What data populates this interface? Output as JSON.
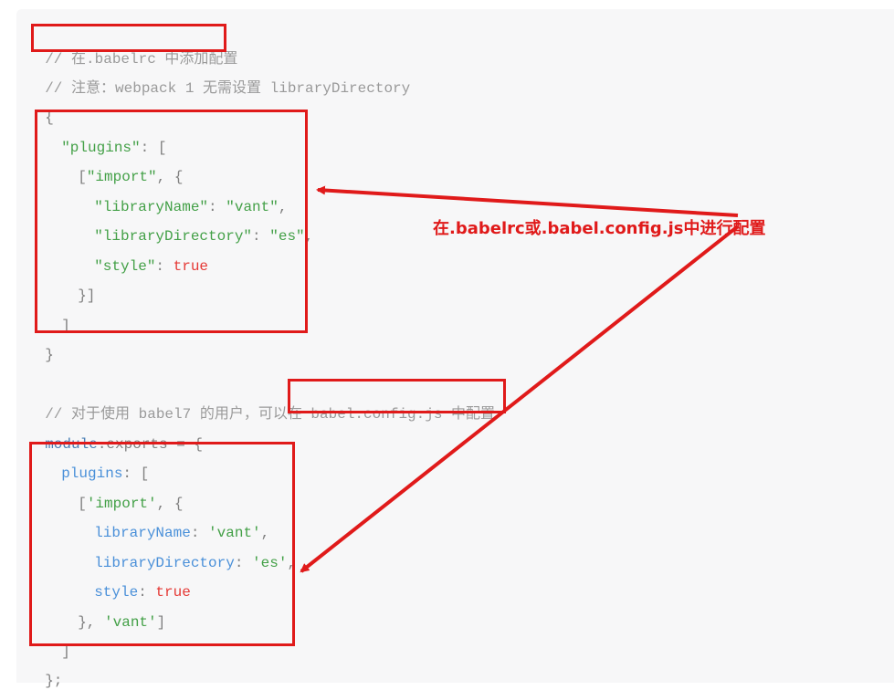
{
  "code": {
    "l1": {
      "c1": "// 在.babelrc 中添加配置"
    },
    "l2": {
      "c1": "// 注意：webpack 1 无需设置 libraryDirectory"
    },
    "l3": {
      "p1": "{"
    },
    "l4": {
      "s1": "\"plugins\"",
      "p1": ": ["
    },
    "l5": {
      "p1": "[",
      "s1": "\"import\"",
      "p2": ", {"
    },
    "l6": {
      "s1": "\"libraryName\"",
      "p1": ": ",
      "s2": "\"vant\"",
      "p2": ","
    },
    "l7": {
      "s1": "\"libraryDirectory\"",
      "p1": ": ",
      "s2": "\"es\"",
      "p2": ","
    },
    "l8": {
      "s1": "\"style\"",
      "p1": ": ",
      "k1": "true"
    },
    "l9": {
      "p1": "}]"
    },
    "l10": {
      "p1": "]"
    },
    "l11": {
      "p1": "}"
    },
    "l12": {
      "c1": "// 对于使用 babel7 的用户，可以在 babel.config.js 中配置"
    },
    "l13": {
      "i1": "module",
      "p1": ".exports = {"
    },
    "l14": {
      "i1": "plugins",
      "p1": ": ["
    },
    "l15": {
      "p1": "[",
      "s1": "'import'",
      "p2": ", {"
    },
    "l16": {
      "i1": "libraryName",
      "p1": ": ",
      "s1": "'vant'",
      "p2": ","
    },
    "l17": {
      "i1": "libraryDirectory",
      "p1": ": ",
      "s1": "'es'",
      "p2": ","
    },
    "l18": {
      "i1": "style",
      "p1": ": ",
      "k1": "true"
    },
    "l19": {
      "p1": "}, ",
      "s1": "'vant'",
      "p2": "]"
    },
    "l20": {
      "p1": "]"
    },
    "l21": {
      "p1": "};"
    }
  },
  "annotation": {
    "text": "在.babelrc或.babel.config.js中进行配置"
  },
  "colors": {
    "highlight": "#e01a1a",
    "string": "#43a047",
    "keyword": "#e53935",
    "property": "#4a90d9",
    "comment": "#9a9a9a",
    "background": "#f7f7f8"
  }
}
